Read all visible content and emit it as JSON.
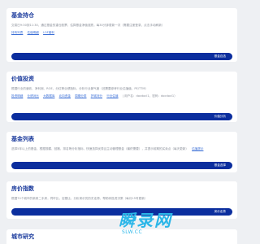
{
  "sections": [
    {
      "title": "基金持仓",
      "desc": "交易日9:30到11:30，通过基金的重仓股票，估算基金净值涨跌，每30分钟更新一次（需要注册登录，点击手动刷新）",
      "links": [
        "持有列表",
        "估值明细",
        "LOF套利"
      ],
      "action": "基金自选"
    },
    {
      "title": "价值投资",
      "desc": "根据行业的营收、净利润、ROE、分红等业绩指标，分析行业景气度（还需要参考行业估值值，PE/TTM）",
      "links": [
        "投资明细",
        "业绩对比",
        "大数据库",
        "北向资金",
        "周期分类",
        "护城河分",
        "行业估值"
      ],
      "extra": "| 用户名：docdocl1，密码：docdocl1）",
      "action": "价值分析"
    },
    {
      "title": "基金列表",
      "desc": "选择5年以上的基金，根据规模、回撤、排名等分析指标，快速选择优秀且主动管理基金（最终需要），并提示前期的买卖点（每天更新）",
      "links": [
        "估值提示"
      ],
      "action": "基金选择"
    },
    {
      "title": "房价指数",
      "desc": "根据70个城市的新房二手房，同环比，定基比，分析房价的历史走势，帮助你投资决策（每月15号更新）",
      "links": [],
      "action": "房价走势"
    },
    {
      "title": "城市研究"
    }
  ],
  "watermark": {
    "text": "瞬录网",
    "url": "SLW.CC"
  }
}
